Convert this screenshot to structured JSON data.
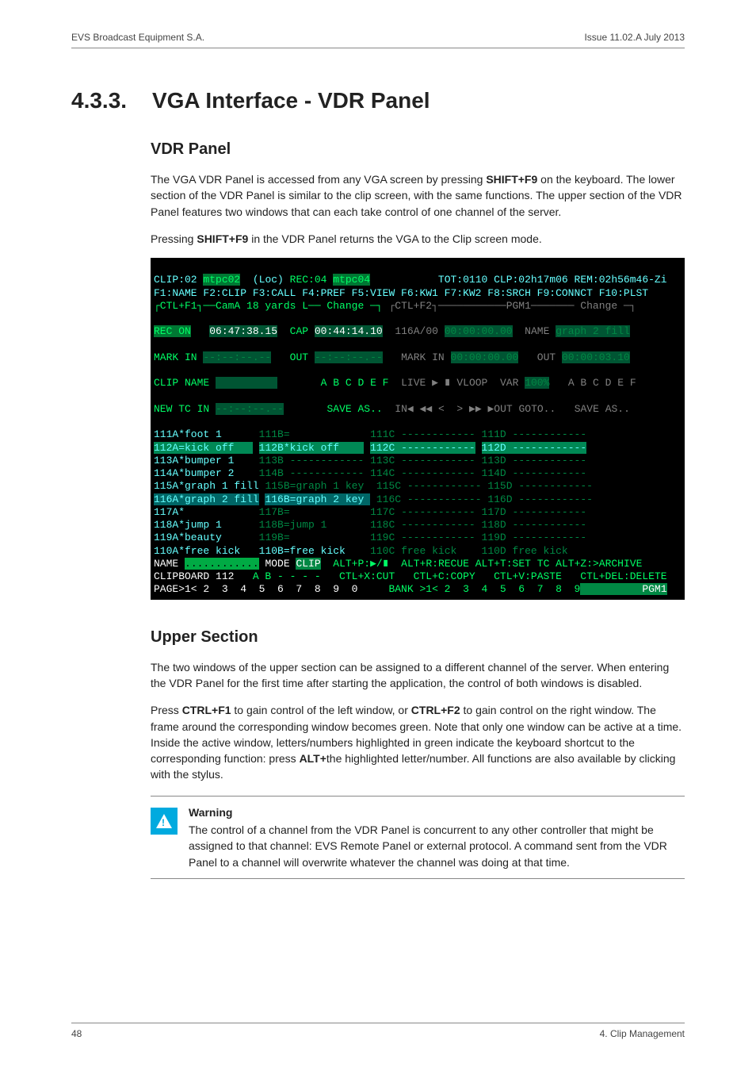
{
  "header": {
    "left": "EVS Broadcast Equipment S.A.",
    "right": "Issue 11.02.A  July 2013"
  },
  "section": {
    "number": "4.3.3.",
    "title": "VGA Interface - VDR Panel"
  },
  "sub1": {
    "heading": "VDR Panel",
    "p1a": "The VGA VDR Panel is accessed from any VGA screen by pressing ",
    "p1b": "SHIFT+F9",
    "p1c": " on the keyboard. The lower section of the VDR Panel is similar to the clip screen, with the same functions. The upper section of the VDR Panel features two windows that can each take control of one channel of the server.",
    "p2a": "Pressing ",
    "p2b": "SHIFT+F9",
    "p2c": " in the VDR Panel returns the VGA to the Clip screen mode."
  },
  "term": {
    "line1": {
      "a": "CLIP:02 ",
      "b": "mtpc02",
      "c": "  (Loc) ",
      "d": "REC:04 ",
      "e": "mtpc04",
      "f": "           TOT:0110 CLP:02h17m06 REM:02h56m46-Zi"
    },
    "line2": "F1:NAME F2:CLIP F3:CALL F4:PREF F5:VIEW F6:KW1 F7:KW2 F8:SRCH F9:CONNCT F10:PLST",
    "line3": {
      "l": "┌CTL+F1┐──CamA 18 yards L── Change ─┐",
      "r": "┌CTL+F2┐───────────PGM1─────── Change ─┐"
    },
    "recRow": {
      "rec": "REC ON",
      "rectc": "06:47:38.15",
      "cap": "CAP",
      "captc": "00:44:14.10",
      "r1": "116A/00",
      "r2": "00:00:00.00",
      "nm": "NAME",
      "nmv": "graph 2 fill"
    },
    "markRow": {
      "m": "MARK IN",
      "mi": "--:--:--.--",
      "o": "OUT",
      "ov": "--:--:--.--",
      "m2": "MARK IN",
      "mv2": "00:00:00.00",
      "o2": "OUT",
      "ov2": "00:00:03.10"
    },
    "clipRow": {
      "c": "CLIP NAME",
      "cv": "          ",
      "abc": "A B C D E F",
      "live": "LIVE ▶ ∎ VLOOP",
      "var": "VAR",
      "pct": "100%",
      "abc2": "A B C D E F"
    },
    "newRow": {
      "n": "NEW TC IN",
      "nv": "--:--:--.--",
      "s": "SAVE AS..",
      "ctl": "IN◀ ◀◀ <  > ▶▶ ▶OUT GOTO..",
      "s2": "SAVE AS.."
    },
    "clips": {
      "r1": {
        "a": "111A*foot 1     ",
        "b": "111B=            ",
        "c": "111C ------------",
        "d": "111D ------------"
      },
      "r2": {
        "a": "112A=kick off   ",
        "b": "112B*kick off    ",
        "c": "112C ------------",
        "d": "112D ------------"
      },
      "r3": {
        "a": "113A*bumper 1   ",
        "b": "113B ------------",
        "c": "113C ------------",
        "d": "113D ------------"
      },
      "r4": {
        "a": "114A*bumper 2   ",
        "b": "114B ------------",
        "c": "114C ------------",
        "d": "114D ------------"
      },
      "r5": {
        "a": "115A*graph 1 fill",
        "b": "115B=graph 1 key ",
        "c": "115C ------------",
        "d": "115D ------------"
      },
      "r6": {
        "a": "116A*graph 2 fill",
        "b": "116B=graph 2 key ",
        "c": "116C ------------",
        "d": "116D ------------"
      },
      "r7": {
        "a": "117A*           ",
        "b": "117B=            ",
        "c": "117C ------------",
        "d": "117D ------------"
      },
      "r8": {
        "a": "118A*jump 1     ",
        "b": "118B=jump 1      ",
        "c": "118C ------------",
        "d": "118D ------------"
      },
      "r9": {
        "a": "119A*beauty     ",
        "b": "119B=            ",
        "c": "119C ------------",
        "d": "119D ------------"
      },
      "r10": {
        "a": "110A*free kick  ",
        "b": "110B=free kick   ",
        "c": "110C free kick   ",
        "d": "110D free kick   "
      }
    },
    "foot1": {
      "a": "NAME ",
      "b": "............",
      "c": " MODE ",
      "d": "CLIP",
      "e": "  ALT+P:▶/∎  ALT+R:RECUE ALT+T:SET TC ALT+Z:>ARCHIVE"
    },
    "foot2": {
      "a": "CLIPBOARD 112   ",
      "b": "A B - - - -",
      "c": "   CTL+X:CUT   CTL+C:COPY   CTL+V:PASTE   CTL+DEL:DELETE"
    },
    "foot3": {
      "a": "PAGE>1< 2  3  4  5  6  7  8  9  0",
      "b": "     BANK >1< 2  3  4  5  6  7  8  9",
      "c": "          PGM1"
    }
  },
  "sub2": {
    "heading": "Upper Section",
    "p1": "The two windows of the upper section can be assigned to a different channel of the server. When entering the VDR Panel for the first time after starting the application, the control of both windows is disabled.",
    "p2a": "Press ",
    "p2b": "CTRL+F1",
    "p2c": " to gain control of the left window, or ",
    "p2d": "CTRL+F2",
    "p2e": " to gain control on the right window. The frame around the corresponding window becomes green. Note that only one window can be active at a time. Inside the active window, letters/numbers highlighted in green indicate the keyboard shortcut to the corresponding function: press ",
    "p2f": "ALT+",
    "p2g": "the highlighted letter/number. All functions are also available by clicking with the stylus."
  },
  "warning": {
    "heading": "Warning",
    "body": "The control of a channel from the VDR Panel is concurrent to any other controller that might be assigned to that channel: EVS Remote Panel or external protocol. A command sent from the VDR Panel to a channel will overwrite whatever the channel was doing at that time."
  },
  "footer": {
    "left": "48",
    "right": "4. Clip Management"
  }
}
